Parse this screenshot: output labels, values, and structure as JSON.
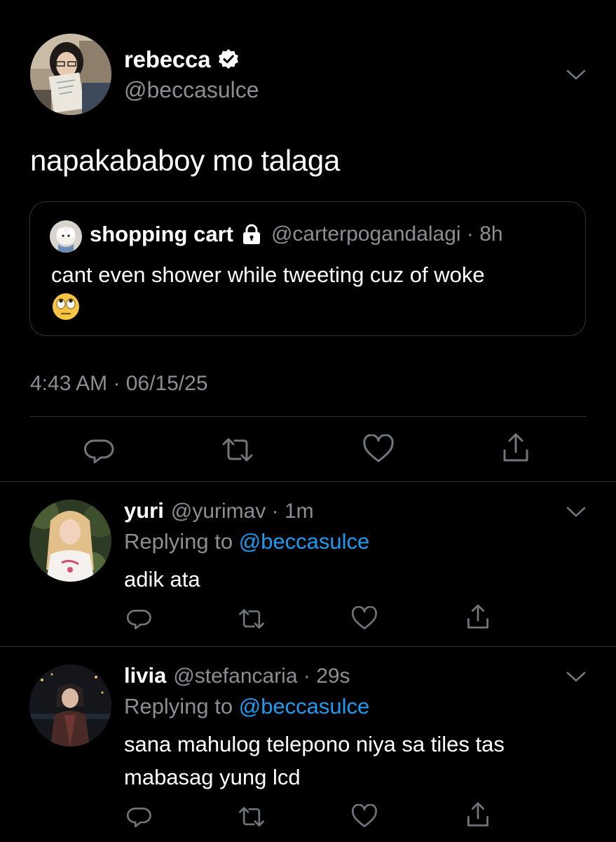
{
  "main_tweet": {
    "display_name": "rebecca",
    "handle": "@beccasulce",
    "text": "napakababoy mo talaga",
    "timestamp": "4:43 AM · 06/15/25",
    "quoted": {
      "display_name": "shopping cart",
      "handle_time": "@carterpogandalagi · 8h",
      "text": "cant even shower while tweeting cuz of woke",
      "emoji": "face-with-rolling-eyes"
    }
  },
  "replies": [
    {
      "display_name": "yuri",
      "handle_time": "@yurimav · 1m",
      "replying_prefix": "Replying to ",
      "replying_to": "@beccasulce",
      "text": "adik ata"
    },
    {
      "display_name": "livia",
      "handle_time": "@stefancaria · 29s",
      "replying_prefix": "Replying to ",
      "replying_to": "@beccasulce",
      "text_line1": "sana mahulog telepono niya sa tiles tas",
      "text_line2": "mabasag yung lcd"
    }
  ],
  "icons": {
    "reply": "reply-icon",
    "retweet": "retweet-icon",
    "like": "like-icon",
    "share": "share-icon",
    "more": "chevron-down-icon",
    "verified": "verified-icon",
    "protected": "lock-icon"
  },
  "colors": {
    "background": "#000000",
    "text_primary": "#ffffff",
    "text_secondary": "#8b8f94",
    "link": "#1d9bf0",
    "divider": "#2f3336"
  }
}
